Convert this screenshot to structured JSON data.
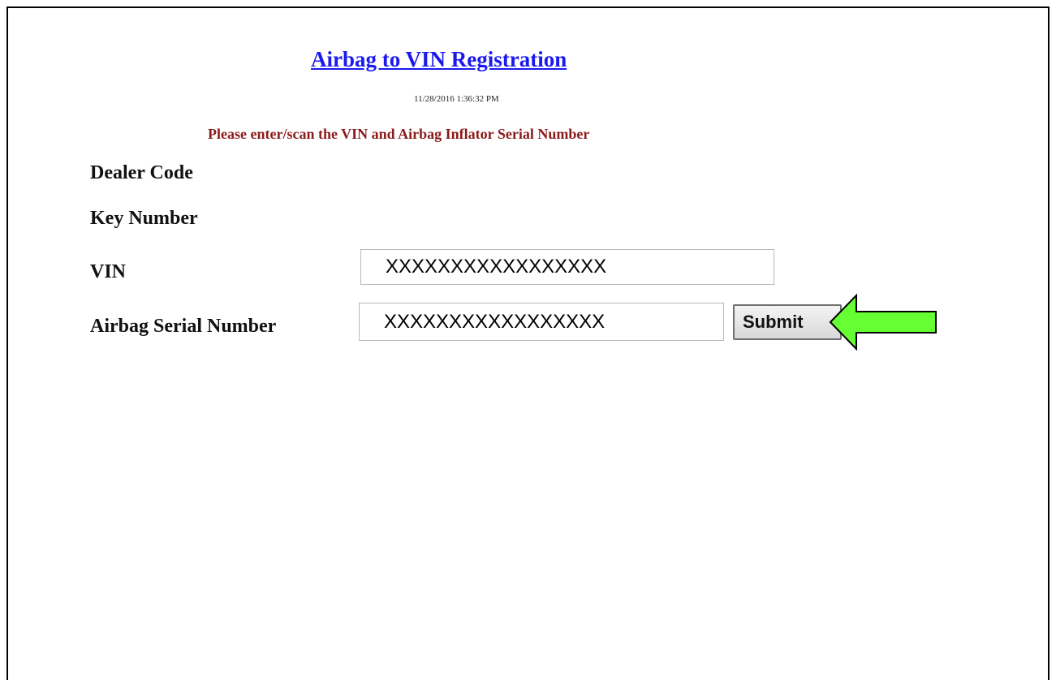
{
  "page": {
    "title": "Airbag to VIN Registration",
    "timestamp": "11/28/2016 1:36:32 PM",
    "instruction": "Please enter/scan the VIN and Airbag Inflator Serial Number"
  },
  "form": {
    "dealer_code_label": "Dealer Code",
    "key_number_label": "Key Number",
    "vin_label": "VIN",
    "vin_value": "XXXXXXXXXXXXXXXXX",
    "airbag_label": "Airbag Serial Number",
    "airbag_value": "XXXXXXXXXXXXXXXXX",
    "submit_label": "Submit"
  },
  "annotation": {
    "arrow_icon": "left-arrow-icon",
    "arrow_color": "#66ff33"
  }
}
